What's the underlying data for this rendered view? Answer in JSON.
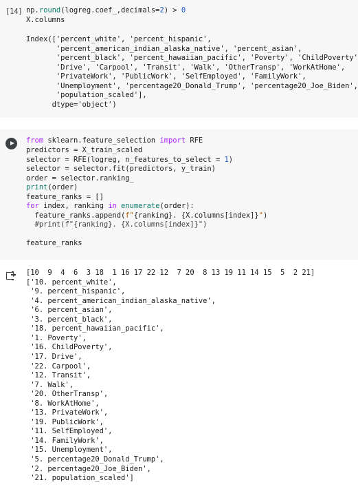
{
  "notebook": {
    "cells": [
      {
        "id": "cell-14",
        "prompt": "[14]",
        "type": "code",
        "code_lines": [
          "np.round(logreg.coef_,decimals=2) > 0",
          "X.columns"
        ],
        "output_lines": [
          "Index(['percent_white', 'percent_hispanic',",
          "       'percent_american_indian_alaska_native', 'percent_asian',",
          "       'percent_black', 'percent_hawaiian_pacific', 'Poverty', 'ChildPoverty',",
          "       'Drive', 'Carpool', 'Transit', 'Walk', 'OtherTransp', 'WorkAtHome',",
          "       'PrivateWork', 'PublicWork', 'SelfEmployed', 'FamilyWork',",
          "       'Unemployment', 'percentage20_Donald_Trump', 'percentage20_Joe_Biden',",
          "       'population_scaled'],",
          "      dtype='object')"
        ]
      },
      {
        "id": "cell-rfe",
        "prompt": "",
        "type": "code",
        "run_button_label": "run-cell",
        "code_lines": [
          "from sklearn.feature_selection import RFE",
          "predictors = X_train_scaled",
          "selector = RFE(logreg, n_features_to_select = 1)",
          "selector = selector.fit(predictors, y_train)",
          "order = selector.ranking_",
          "print(order)",
          "feature_ranks = []",
          "for index, ranking in enumerate(order):",
          "  feature_ranks.append(f\"{ranking}. {X.columns[index]}\")",
          "  #print(f\"{ranking}. {X.columns[index]}\")",
          "",
          "feature_ranks"
        ]
      }
    ]
  },
  "output": {
    "icon": "output-arrow-icon",
    "ranking_array_line": "[10  9  4  6  3 18  1 16 17 22 12  7 20  8 13 19 11 14 15  5  2 21]",
    "feature_ranks_lines": [
      "['10. percent_white',",
      " '9. percent_hispanic',",
      " '4. percent_american_indian_alaska_native',",
      " '6. percent_asian',",
      " '3. percent_black',",
      " '18. percent_hawaiian_pacific',",
      " '1. Poverty',",
      " '16. ChildPoverty',",
      " '17. Drive',",
      " '22. Carpool',",
      " '12. Transit',",
      " '7. Walk',",
      " '20. OtherTransp',",
      " '8. WorkAtHome',",
      " '13. PrivateWork',",
      " '19. PublicWork',",
      " '11. SelfEmployed',",
      " '14. FamilyWork',",
      " '15. Unemployment',",
      " '5. percentage20_Donald_Trump',",
      " '2. percentage20_Joe_Biden',",
      " '21. population_scaled']"
    ],
    "ranking_values": [
      10,
      9,
      4,
      6,
      3,
      18,
      1,
      16,
      17,
      22,
      12,
      7,
      20,
      8,
      13,
      19,
      11,
      14,
      15,
      5,
      2,
      21
    ],
    "feature_names": [
      "percent_white",
      "percent_hispanic",
      "percent_american_indian_alaska_native",
      "percent_asian",
      "percent_black",
      "percent_hawaiian_pacific",
      "Poverty",
      "ChildPoverty",
      "Drive",
      "Carpool",
      "Transit",
      "Walk",
      "OtherTransp",
      "WorkAtHome",
      "PrivateWork",
      "PublicWork",
      "SelfEmployed",
      "FamilyWork",
      "Unemployment",
      "percentage20_Donald_Trump",
      "percentage20_Joe_Biden",
      "population_scaled"
    ]
  },
  "colors": {
    "cell_background": "#f7f7f7",
    "page_background": "#ffffff",
    "keyword": "#aa22ff",
    "function": "#0d7d6c",
    "number": "#1a57c4",
    "string_prefix": "#b35a00",
    "text": "#202124"
  }
}
